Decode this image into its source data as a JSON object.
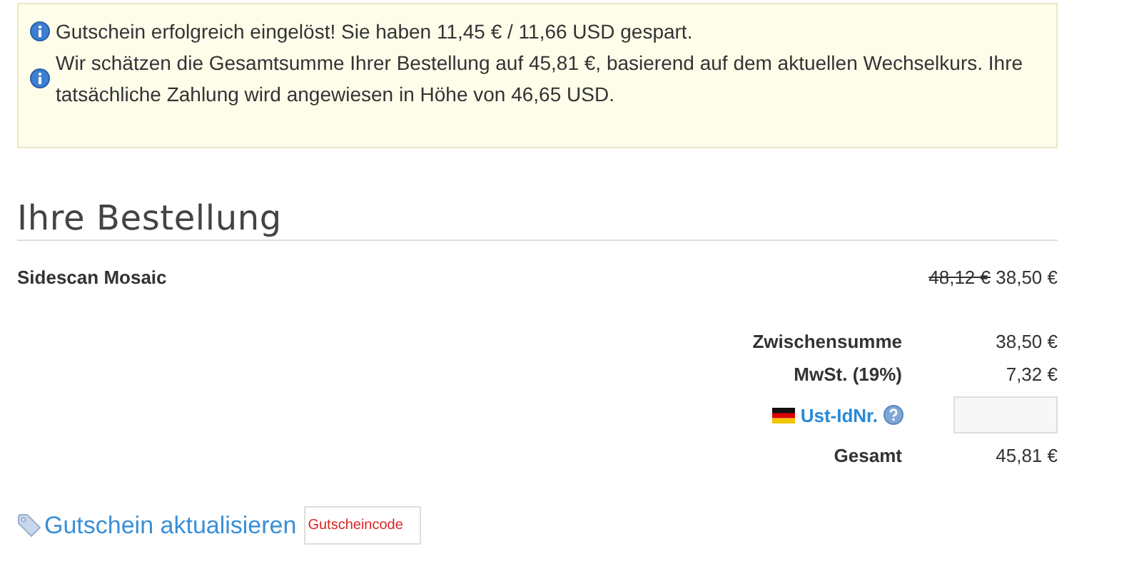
{
  "notices": [
    {
      "text": "Gutschein erfolgreich eingelöst! Sie haben 11,45 € / 11,66 USD gespart."
    },
    {
      "text": "Wir schätzen die Gesamtsumme Ihrer Bestellung auf 45,81 €, basierend auf dem aktuellen Wechselkurs. Ihre tatsächliche Zahlung wird angewiesen in Höhe von 46,65 USD."
    }
  ],
  "heading": "Ihre Bestellung",
  "items": [
    {
      "name": "Sidescan Mosaic",
      "old_price": "48,12 €",
      "price": "38,50 €"
    }
  ],
  "totals": [
    {
      "kind": "amount",
      "label": "Zwischensumme",
      "value": "38,50 €"
    },
    {
      "kind": "amount",
      "label": "MwSt. (19%)",
      "value": "7,32 €"
    },
    {
      "kind": "vat_id",
      "label": "Ust-IdNr."
    },
    {
      "kind": "amount",
      "label": "Gesamt",
      "value": "45,81 €"
    }
  ],
  "coupon": {
    "link": "Gutschein aktualisieren",
    "placeholder": "Gutscheincode"
  }
}
